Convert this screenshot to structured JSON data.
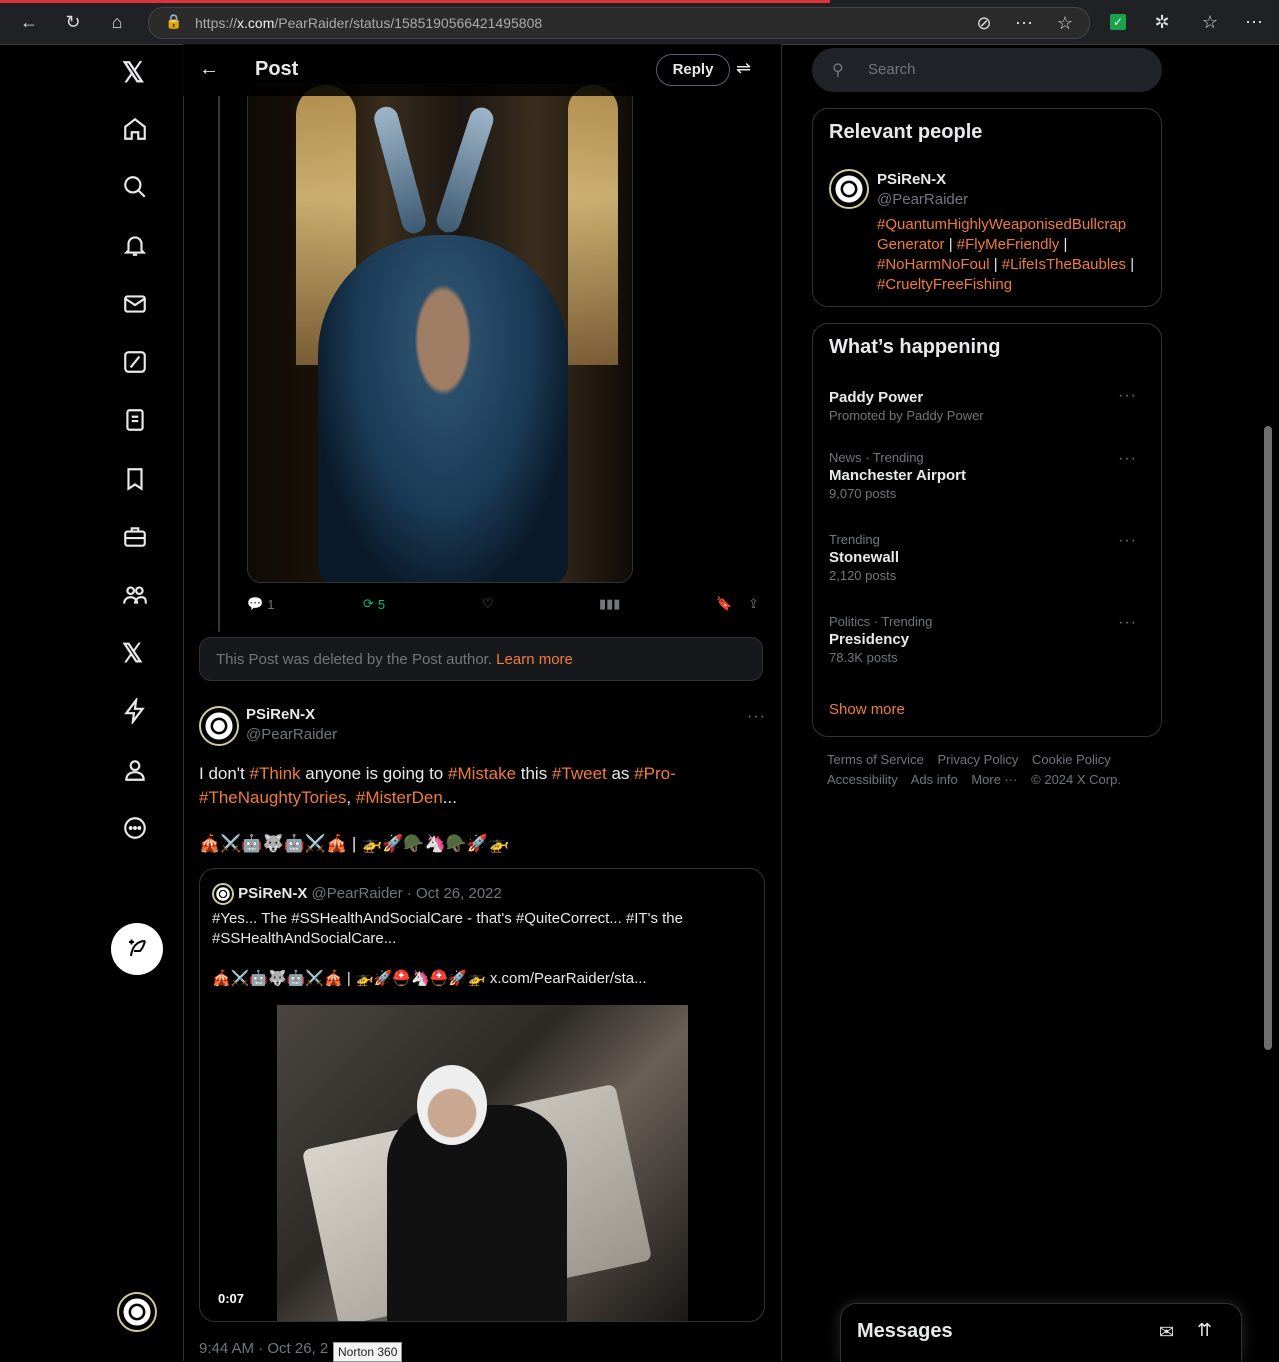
{
  "browser": {
    "url_prefix": "https://",
    "url_host": "x.com",
    "url_path": "/PearRaider/status/1585190566421495808"
  },
  "header": {
    "title": "Post",
    "reply_label": "Reply"
  },
  "thread_actions": {
    "replies": "1",
    "reposts": "5"
  },
  "deleted_notice": {
    "text": "This Post was deleted by the Post author.",
    "link": "Learn more"
  },
  "post": {
    "name": "PSiReN-X",
    "handle": "@PearRaider",
    "text_html": "I don't <span class=\"link\">#Think</span> anyone is going to <span class=\"link\">#Mistake</span> this <span class=\"link\">#Tweet</span> as <span class=\"link\">#Pro-</span><br><span class=\"link\">#TheNaughtyTories</span>, <span class=\"link\">#MisterDen</span>...",
    "emoji_line": "🎪⚔️🤖🐺🤖⚔️🎪 | 🚁🚀🪖🦄🪖🚀🚁",
    "timestamp": "9:44 AM · Oct 26, 2"
  },
  "quote": {
    "name": "PSiReN-X",
    "meta": "@PearRaider · Oct 26, 2022",
    "text": "#Yes... The #SSHealthAndSocialCare - that's #QuiteCorrect... #IT's the #SSHealthAndSocialCare...",
    "emoji_line": "🎪⚔️🤖🐺🤖⚔️🎪 | 🚁🚀⛑️🦄⛑️🚀🚁  x.com/PearRaider/sta...",
    "duration": "0:07"
  },
  "tooltip": "Norton 360",
  "search": {
    "placeholder": "Search"
  },
  "relevant": {
    "title": "Relevant people",
    "name": "PSiReN-X",
    "handle": "@PearRaider",
    "bio_html": "<span class=\"link\">#QuantumHighlyWeaponisedBullcrap Generator</span> | <span class=\"link\">#FlyMeFriendly</span> | <span class=\"link\">#NoHarmNoFoul</span> | <span class=\"link\">#LifeIsTheBaubles</span> | <span class=\"link\">#CrueltyFreeFishing</span>"
  },
  "happening": {
    "title": "What’s happening",
    "trends": [
      {
        "meta": "",
        "name": "Paddy Power",
        "sub": "Promoted by Paddy Power"
      },
      {
        "meta": "News · Trending",
        "name": "Manchester Airport",
        "sub": "9,070 posts"
      },
      {
        "meta": "Trending",
        "name": "Stonewall",
        "sub": "2,120 posts"
      },
      {
        "meta": "Politics · Trending",
        "name": "Presidency",
        "sub": "78.3K posts"
      }
    ],
    "show_more": "Show more"
  },
  "footer": {
    "links": [
      "Terms of Service",
      "Privacy Policy",
      "Cookie Policy",
      "Accessibility",
      "Ads info",
      "More ···",
      "© 2024 X Corp."
    ]
  },
  "messages": {
    "title": "Messages"
  }
}
